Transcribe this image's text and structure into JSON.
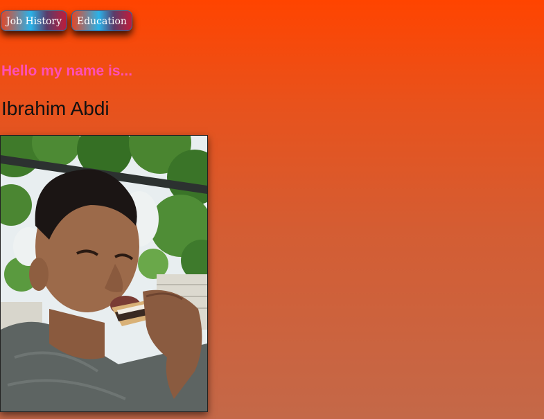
{
  "nav": {
    "items": [
      {
        "label": "Job History"
      },
      {
        "label": "Education"
      }
    ]
  },
  "header": {
    "greeting": "Hello my name is...",
    "name": "Ibrahim Abdi"
  },
  "colors": {
    "background_top": "#ff4400",
    "background_bottom": "#c46848",
    "greeting": "#ff4fb8",
    "name": "#111111"
  }
}
